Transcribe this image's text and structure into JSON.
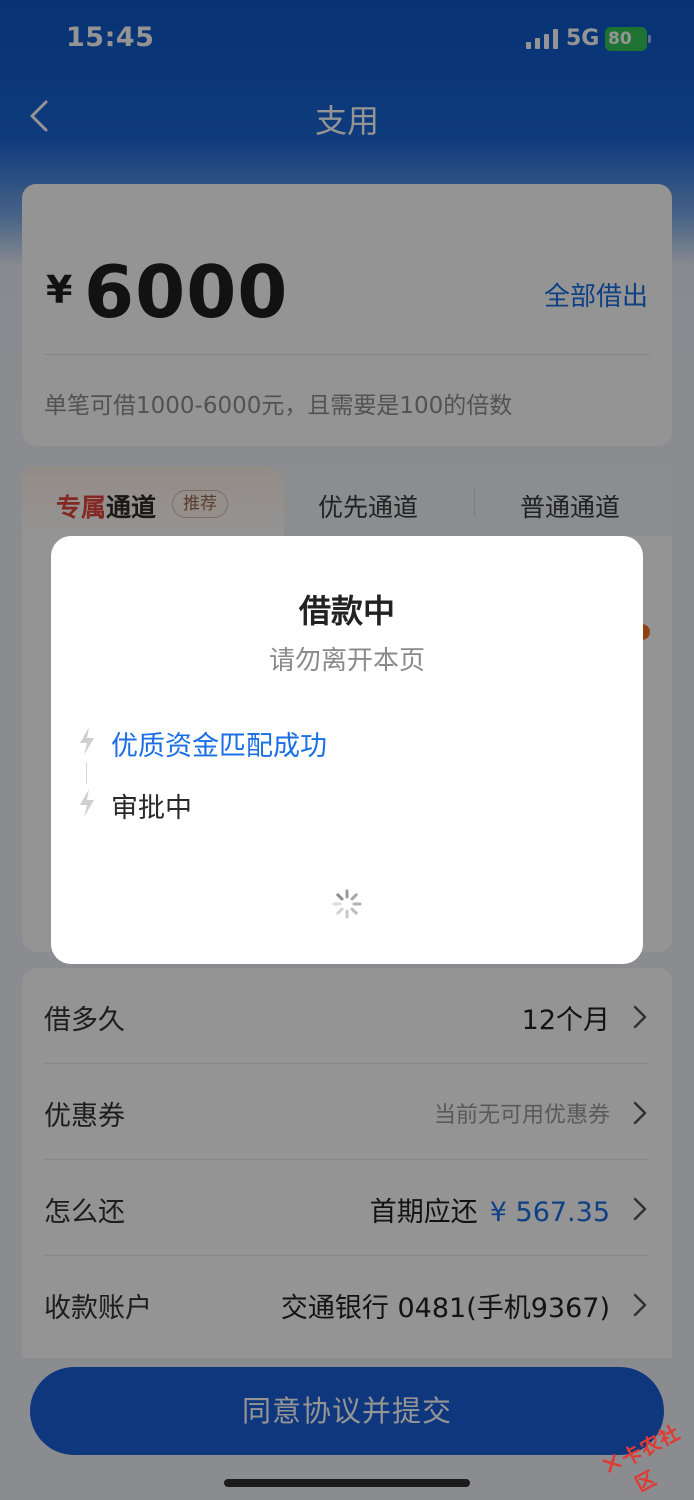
{
  "status_bar": {
    "time": "15:45",
    "network": "5G",
    "battery": "80"
  },
  "nav": {
    "title": "支用"
  },
  "amount": {
    "currency": "¥",
    "value": "6000",
    "borrow_all_label": "全部借出",
    "hint": "单笔可借1000-6000元，且需要是100的倍数"
  },
  "channels": {
    "active_part1": "专属",
    "active_part2": "通道",
    "active_badge": "推荐",
    "priority": "优先通道",
    "normal": "普通通道"
  },
  "details": {
    "term_label": "借多久",
    "term_value": "12个月",
    "coupon_label": "优惠券",
    "coupon_value": "当前无可用优惠券",
    "repay_label": "怎么还",
    "repay_prefix": "首期应还",
    "repay_amount": "¥ 567.35",
    "account_label": "收款账户",
    "account_value": "交通银行 0481(手机9367)"
  },
  "submit_label": "同意协议并提交",
  "modal": {
    "title": "借款中",
    "subtitle": "请勿离开本页",
    "steps": [
      {
        "label": "优质资金匹配成功",
        "status": "done"
      },
      {
        "label": "审批中",
        "status": "current"
      }
    ]
  },
  "watermark": "卡农社区",
  "colors": {
    "primary_blue": "#1a6fe6",
    "accent_red": "#e2453c",
    "button_blue": "#1a5fd8"
  }
}
